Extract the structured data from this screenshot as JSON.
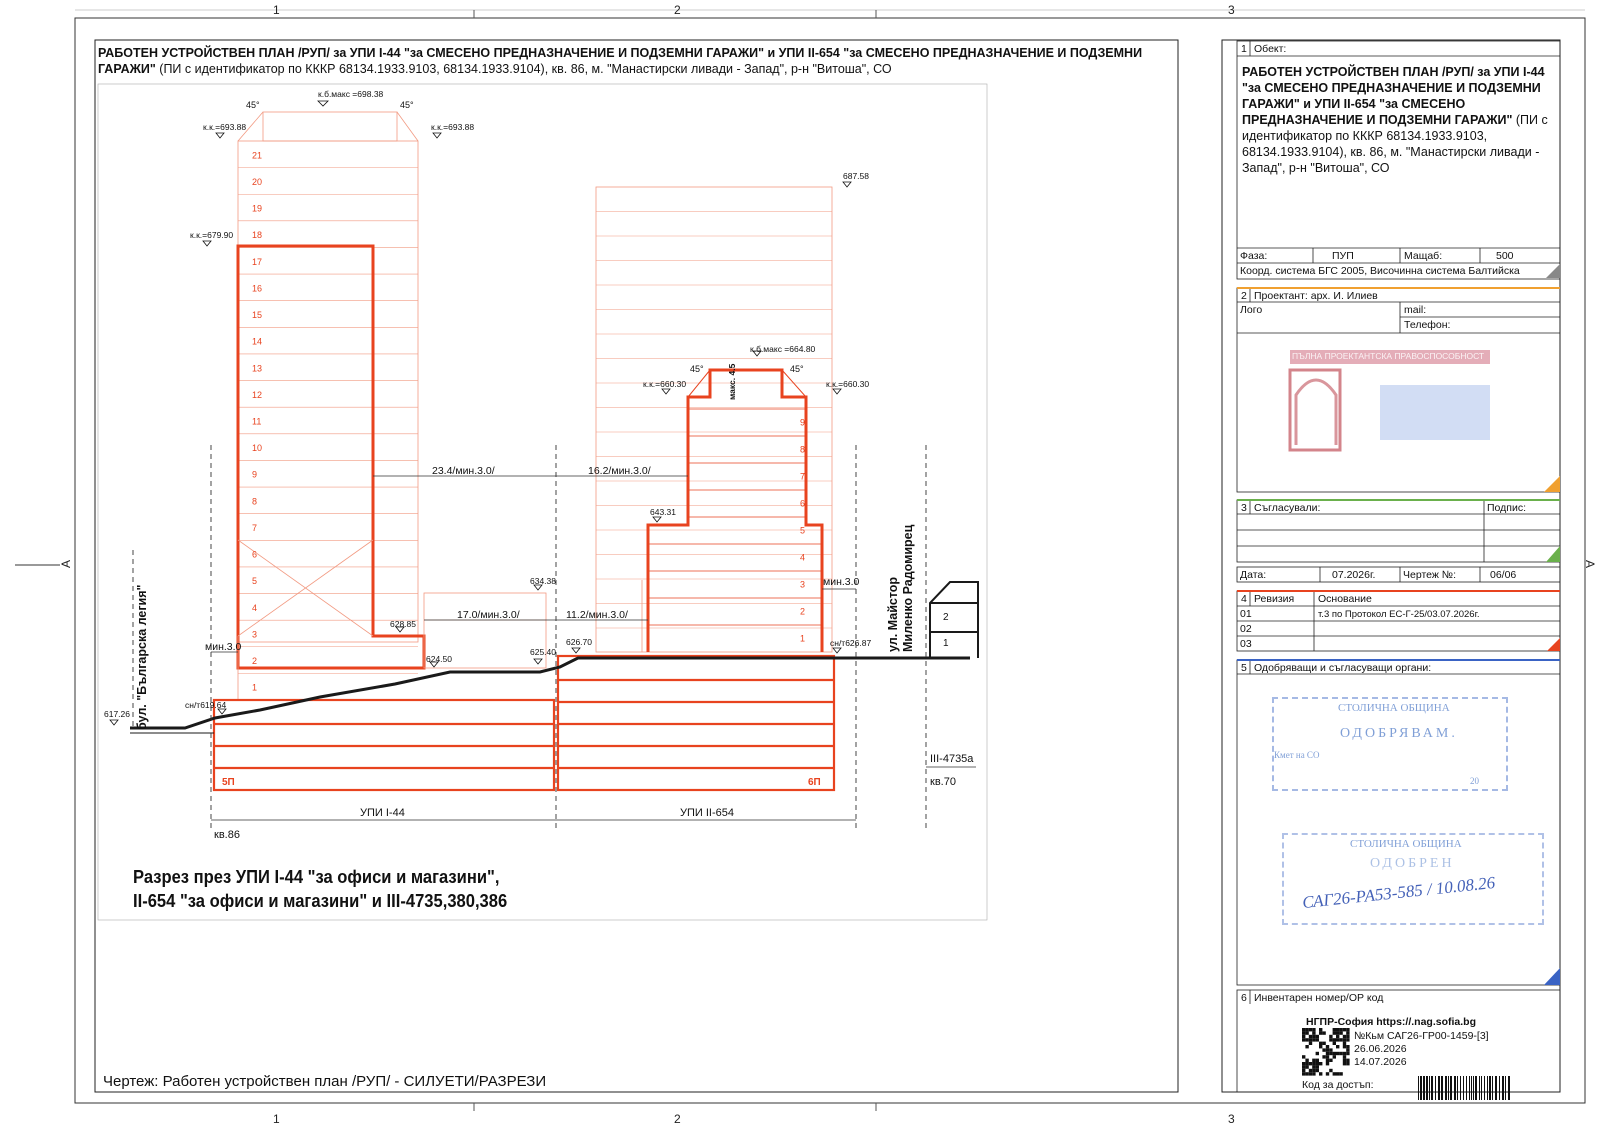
{
  "frame": {
    "col_numbers": [
      "1",
      "2",
      "3"
    ],
    "row_letter": "A"
  },
  "header": {
    "title_bold": "РАБОТЕН УСТРОЙСТВЕН ПЛАН /РУП/ за УПИ I-44 \"за СМЕСЕНО ПРЕДНАЗНАЧЕНИЕ И ПОДЗЕМНИ ГАРАЖИ\" и УПИ II-654 \"за СМЕСЕНО ПРЕДНАЗНАЧЕНИЕ И ПОДЗЕМНИ ГАРАЖИ\"",
    "title_rest": " (ПИ с идентификатор по КККР 68134.1933.9103, 68134.1933.9104), кв. 86, м. \"Манастирски ливади - Запад\", р-н \"Витоша\", СО"
  },
  "drawing": {
    "building1_floors": [
      "21",
      "20",
      "19",
      "18",
      "17",
      "16",
      "15",
      "14",
      "13",
      "12",
      "11",
      "10",
      "9",
      "8",
      "7",
      "6",
      "5",
      "4",
      "3",
      "2",
      "1"
    ],
    "building2_floors": [
      "9",
      "8",
      "7",
      "6",
      "5",
      "4",
      "3",
      "2",
      "1"
    ],
    "neighbor_floors": [
      "2",
      "1"
    ],
    "levels": {
      "kb_max_1": "к.б.макс =698.38",
      "kk_left_1": "к.к.=693.88",
      "kk_right_1": "к.к.=693.88",
      "kk_679": "к.к.=679.90",
      "lvl_687": "687.58",
      "kb_max_2": "к.б.макс =664.80",
      "kk_left_2": "к.к.=660.30",
      "kk_right_2": "к.к.=660.30",
      "lvl_643": "643.31",
      "lvl_634": "634.38",
      "lvl_628": "628.85",
      "lvl_626": "626.70",
      "lvl_625": "625.40",
      "lvl_624": "624.50",
      "snt_626": "сн/т626.87",
      "snt_619": "сн/т619.64",
      "lvl_617": "617.26"
    },
    "angle": "45°",
    "max_label": "макс. 4.5",
    "distances": {
      "d1": "23.4/мин.3.0/",
      "d2": "16.2/мин.3.0/",
      "d3": "17.0/мин.3.0/",
      "d4": "11.2/мин.3.0/",
      "min_left": "мин.3.0",
      "min_right": "мин.3.0"
    },
    "underground": {
      "left": "5П",
      "right": "6П"
    },
    "plots": {
      "upi1": "УПИ I-44",
      "upi2": "УПИ II-654",
      "block": "кв.86",
      "block70": "кв.70",
      "plot3": "III-4735а"
    },
    "streets": {
      "street1": "бул. \"Българска легия\"",
      "street2a": "ул. Майстор",
      "street2b": "Миленко Радомирец"
    }
  },
  "section_caption": {
    "line1": "Разрез през УПИ I-44 \"за офиси и магазини\",",
    "line2": "II-654 \"за офиси и магазини\" и III-4735,380,386"
  },
  "drawing_label": "Чертеж:  Работен устройствен план /РУП/ - СИЛУЕТИ/РАЗРЕЗИ",
  "titleblock": {
    "s1_num": "1",
    "s1_label": "Обект:",
    "object_bold": "РАБОТЕН УСТРОЙСТВЕН ПЛАН /РУП/ за УПИ I-44 \"за СМЕСЕНО ПРЕДНАЗНАЧЕНИЕ И ПОДЗЕМНИ ГАРАЖИ\" и УПИ II-654 \"за СМЕСЕНО ПРЕДНАЗНАЧЕНИЕ И ПОДЗЕМНИ ГАРАЖИ\"",
    "object_rest": " (ПИ с идентификатор по КККР 68134.1933.9103, 68134.1933.9104), кв. 86, м. \"Манастирски ливади - Запад\", р-н \"Витоша\", СО",
    "phase_label": "Фаза:",
    "phase_value": "ПУП",
    "scale_label": "Мащаб:",
    "scale_value": "500",
    "coord": "Коорд. система БГС 2005, Височинна система Балтийска",
    "s2_num": "2",
    "designer": "Проектант: арх. И. Илиев",
    "logo": "Лого",
    "mail": "mail:",
    "phone": "Телефон:",
    "stamp1_text": "ПЪЛНА ПРОЕКТАНТСКА ПРАВОСПОСОБНОСТ",
    "s3_num": "3",
    "agreed": "Съгласували:",
    "signature": "Подпис:",
    "date_label": "Дата:",
    "date_value": "07.2026г.",
    "sheet_label": "Чертеж №:",
    "sheet_value": "06/06",
    "s4_num": "4",
    "revision_label": "Ревизия",
    "basis_label": "Основание",
    "rev_rows": [
      {
        "num": "01",
        "basis": "т.3 по Протокол ЕС-Г-25/03.07.2026г."
      },
      {
        "num": "02",
        "basis": ""
      },
      {
        "num": "03",
        "basis": ""
      }
    ],
    "s5_num": "5",
    "approving": "Одобряващи и съгласуващи органи:",
    "stamp_a_1": "СТОЛИЧНА ОБЩИНА",
    "stamp_a_2": "ОДОБРЯВАМ.",
    "stamp_a_3": "Кмет на СО",
    "stamp_a_4": "20",
    "stamp_b_1": "СТОЛИЧНА ОБЩИНА",
    "stamp_b_2": "ОДОБРЕН",
    "handwritten": "САГ26-РА53-585 / 10.08.26",
    "s6_num": "6",
    "inventory": "Инвентарен номер/ОР код",
    "qr_line1": "НГПР-София   https://.nag.sofia.bg",
    "qr_line2": "№Кьм САГ26-ГР00-1459-[3]",
    "qr_line3": "26.06.2026",
    "qr_line4": "14.07.2026",
    "access_code": "Код за достъп:"
  },
  "colors": {
    "building_red": "#e8431f",
    "light_red": "#f29a82",
    "ground": "#1a1a1a",
    "stamp_blue": "#6a8fd0"
  }
}
